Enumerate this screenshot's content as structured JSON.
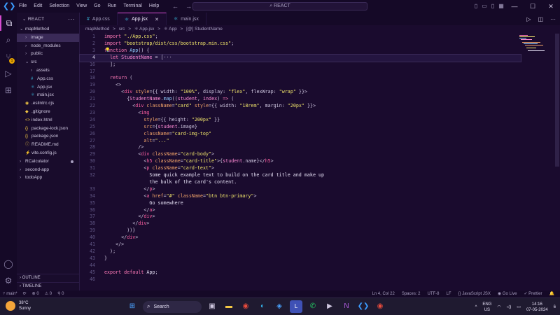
{
  "titlebar": {
    "menu": [
      "File",
      "Edit",
      "Selection",
      "View",
      "Go",
      "Run",
      "Terminal",
      "Help"
    ],
    "search_text": "REACT",
    "back_arrow": "←",
    "forward_arrow": "→"
  },
  "sidebar": {
    "header": "REACT",
    "more": "···",
    "items": [
      {
        "label": "mapMethod",
        "depth": 0,
        "type": "folder-open"
      },
      {
        "label": "image",
        "depth": 1,
        "type": "folder",
        "selected": true
      },
      {
        "label": "node_modules",
        "depth": 1,
        "type": "folder"
      },
      {
        "label": "public",
        "depth": 1,
        "type": "folder"
      },
      {
        "label": "src",
        "depth": 1,
        "type": "folder-open"
      },
      {
        "label": "assets",
        "depth": 2,
        "type": "folder"
      },
      {
        "label": "App.css",
        "depth": 2,
        "type": "css",
        "icon": "#"
      },
      {
        "label": "App.jsx",
        "depth": 2,
        "type": "react",
        "icon": "⚛"
      },
      {
        "label": "main.jsx",
        "depth": 2,
        "type": "react",
        "icon": "⚛"
      },
      {
        "label": ".eslintrc.cjs",
        "depth": 1,
        "type": "file",
        "icon": "◉"
      },
      {
        "label": ".gitignore",
        "depth": 1,
        "type": "file",
        "icon": "◆"
      },
      {
        "label": "index.html",
        "depth": 1,
        "type": "file",
        "icon": "<>"
      },
      {
        "label": "package-lock.json",
        "depth": 1,
        "type": "file",
        "icon": "{}"
      },
      {
        "label": "package.json",
        "depth": 1,
        "type": "file",
        "icon": "{}"
      },
      {
        "label": "README.md",
        "depth": 1,
        "type": "file",
        "icon": "ⓘ"
      },
      {
        "label": "vite.config.js",
        "depth": 1,
        "type": "file",
        "icon": "⚡"
      },
      {
        "label": "RCalculator",
        "depth": 0,
        "type": "folder",
        "modified": true
      },
      {
        "label": "second-app",
        "depth": 0,
        "type": "folder"
      },
      {
        "label": "todoApp",
        "depth": 0,
        "type": "folder"
      }
    ],
    "outline": "OUTLINE",
    "timeline": "TIMELINE"
  },
  "tabs": [
    {
      "label": "App.css",
      "icon": "#",
      "active": false
    },
    {
      "label": "App.jsx",
      "icon": "⚛",
      "active": true,
      "close": "✕"
    },
    {
      "label": "main.jsx",
      "icon": "⚛",
      "active": false
    }
  ],
  "breadcrumb": [
    "mapMethod",
    ">",
    "src",
    ">",
    "⚛ App.jsx",
    ">",
    "⚛ App",
    ">",
    "[@] StudentName"
  ],
  "editor": {
    "current_line": 4,
    "lines": [
      {
        "n": "1",
        "t": [
          [
            "t-kw",
            "import "
          ],
          [
            "t-str",
            "\"./App.css\""
          ],
          [
            "t-pun",
            ";"
          ]
        ]
      },
      {
        "n": "2",
        "t": [
          [
            "t-kw",
            "import "
          ],
          [
            "t-str",
            "\"bootstrap/dist/css/bootstrap.min.css\""
          ],
          [
            "t-pun",
            ";"
          ]
        ]
      },
      {
        "n": "3",
        "t": [
          [
            "t-kw",
            "function "
          ],
          [
            "t-fn",
            "App"
          ],
          [
            "t-pun",
            "() {"
          ]
        ]
      },
      {
        "n": "4",
        "t": [
          [
            "t-pun",
            "  "
          ],
          [
            "t-kw",
            "let "
          ],
          [
            "t-var",
            "StudentName"
          ],
          [
            "t-pun",
            " = "
          ],
          [
            "t-pun",
            "[···"
          ]
        ]
      },
      {
        "n": "16",
        "t": [
          [
            "t-pun",
            "  ];"
          ]
        ]
      },
      {
        "n": "17",
        "t": [
          [
            "t-pun",
            ""
          ]
        ]
      },
      {
        "n": "18",
        "t": [
          [
            "t-pun",
            "  "
          ],
          [
            "t-kw",
            "return"
          ],
          [
            "t-pun",
            " ("
          ]
        ]
      },
      {
        "n": "19",
        "t": [
          [
            "t-pun",
            "    <>"
          ]
        ]
      },
      {
        "n": "20",
        "t": [
          [
            "t-pun",
            "      <"
          ],
          [
            "t-tag",
            "div"
          ],
          [
            "t-attr",
            " style"
          ],
          [
            "t-pun",
            "={{ width: "
          ],
          [
            "t-str",
            "\"100%\""
          ],
          [
            "t-pun",
            ", display: "
          ],
          [
            "t-str",
            "\"flex\""
          ],
          [
            "t-pun",
            ", flexWrap: "
          ],
          [
            "t-str",
            "\"wrap\""
          ],
          [
            "t-pun",
            " }}>"
          ]
        ]
      },
      {
        "n": "21",
        "t": [
          [
            "t-pun",
            "        {"
          ],
          [
            "t-var",
            "StudentName"
          ],
          [
            "t-pun",
            "."
          ],
          [
            "t-fn",
            "map"
          ],
          [
            "t-pun",
            "(("
          ],
          [
            "t-var",
            "student"
          ],
          [
            "t-pun",
            ", "
          ],
          [
            "t-var",
            "index"
          ],
          [
            "t-pun",
            ") "
          ],
          [
            "t-kw",
            "=>"
          ],
          [
            "t-pun",
            " ("
          ]
        ]
      },
      {
        "n": "22",
        "t": [
          [
            "t-pun",
            "          <"
          ],
          [
            "t-tag",
            "div"
          ],
          [
            "t-attr",
            " className"
          ],
          [
            "t-pun",
            "="
          ],
          [
            "t-str",
            "\"card\""
          ],
          [
            "t-attr",
            " style"
          ],
          [
            "t-pun",
            "={{ width: "
          ],
          [
            "t-str",
            "\"18rem\""
          ],
          [
            "t-pun",
            ", margin: "
          ],
          [
            "t-str",
            "\"20px\""
          ],
          [
            "t-pun",
            " }}>"
          ]
        ]
      },
      {
        "n": "23",
        "t": [
          [
            "t-pun",
            "            <"
          ],
          [
            "t-tag",
            "img"
          ]
        ]
      },
      {
        "n": "24",
        "t": [
          [
            "t-attr",
            "              style"
          ],
          [
            "t-pun",
            "={{ height: "
          ],
          [
            "t-str",
            "\"200px\""
          ],
          [
            "t-pun",
            " }}"
          ]
        ]
      },
      {
        "n": "25",
        "t": [
          [
            "t-attr",
            "              src"
          ],
          [
            "t-pun",
            "={"
          ],
          [
            "t-var",
            "student"
          ],
          [
            "t-pun",
            ".image}"
          ]
        ]
      },
      {
        "n": "26",
        "t": [
          [
            "t-attr",
            "              className"
          ],
          [
            "t-pun",
            "="
          ],
          [
            "t-str",
            "\"card-img-top\""
          ]
        ]
      },
      {
        "n": "27",
        "t": [
          [
            "t-attr",
            "              alt"
          ],
          [
            "t-pun",
            "="
          ],
          [
            "t-str",
            "\"...\""
          ]
        ]
      },
      {
        "n": "28",
        "t": [
          [
            "t-pun",
            "            />"
          ]
        ]
      },
      {
        "n": "29",
        "t": [
          [
            "t-pun",
            "            <"
          ],
          [
            "t-tag",
            "div"
          ],
          [
            "t-attr",
            " className"
          ],
          [
            "t-pun",
            "="
          ],
          [
            "t-str",
            "\"card-body\""
          ],
          [
            "t-pun",
            ">"
          ]
        ]
      },
      {
        "n": "30",
        "t": [
          [
            "t-pun",
            "              <"
          ],
          [
            "t-tag",
            "h5"
          ],
          [
            "t-attr",
            " className"
          ],
          [
            "t-pun",
            "="
          ],
          [
            "t-str",
            "\"card-title\""
          ],
          [
            "t-pun",
            ">{"
          ],
          [
            "t-var",
            "student"
          ],
          [
            "t-pun",
            ".name}</"
          ],
          [
            "t-tag",
            "h5"
          ],
          [
            "t-pun",
            ">"
          ]
        ]
      },
      {
        "n": "31",
        "t": [
          [
            "t-pun",
            "              <"
          ],
          [
            "t-tag",
            "p"
          ],
          [
            "t-attr",
            " className"
          ],
          [
            "t-pun",
            "="
          ],
          [
            "t-str",
            "\"card-text\""
          ],
          [
            "t-pun",
            ">"
          ]
        ]
      },
      {
        "n": "32",
        "t": [
          [
            "t-txt",
            "                Some quick example text to build on the card title and make up"
          ]
        ]
      },
      {
        "n": "",
        "t": [
          [
            "t-txt",
            "                the bulk of the card's content."
          ]
        ]
      },
      {
        "n": "33",
        "t": [
          [
            "t-pun",
            "              </"
          ],
          [
            "t-tag",
            "p"
          ],
          [
            "t-pun",
            ">"
          ]
        ]
      },
      {
        "n": "34",
        "t": [
          [
            "t-pun",
            "              <"
          ],
          [
            "t-tag",
            "a"
          ],
          [
            "t-attr",
            " href"
          ],
          [
            "t-pun",
            "="
          ],
          [
            "t-str",
            "\"#\""
          ],
          [
            "t-attr",
            " className"
          ],
          [
            "t-pun",
            "="
          ],
          [
            "t-str",
            "\"btn btn-primary\""
          ],
          [
            "t-pun",
            ">"
          ]
        ]
      },
      {
        "n": "35",
        "t": [
          [
            "t-txt",
            "                Go somewhere"
          ]
        ]
      },
      {
        "n": "36",
        "t": [
          [
            "t-pun",
            "              </"
          ],
          [
            "t-tag",
            "a"
          ],
          [
            "t-pun",
            ">"
          ]
        ]
      },
      {
        "n": "37",
        "t": [
          [
            "t-pun",
            "            </"
          ],
          [
            "t-tag",
            "div"
          ],
          [
            "t-pun",
            ">"
          ]
        ]
      },
      {
        "n": "38",
        "t": [
          [
            "t-pun",
            "          </"
          ],
          [
            "t-tag",
            "div"
          ],
          [
            "t-pun",
            ">"
          ]
        ]
      },
      {
        "n": "39",
        "t": [
          [
            "t-pun",
            "        ))}"
          ]
        ]
      },
      {
        "n": "40",
        "t": [
          [
            "t-pun",
            "      </"
          ],
          [
            "t-tag",
            "div"
          ],
          [
            "t-pun",
            ">"
          ]
        ]
      },
      {
        "n": "41",
        "t": [
          [
            "t-pun",
            "    </>"
          ]
        ]
      },
      {
        "n": "42",
        "t": [
          [
            "t-pun",
            "  );"
          ]
        ]
      },
      {
        "n": "43",
        "t": [
          [
            "t-pun",
            "}"
          ]
        ]
      },
      {
        "n": "44",
        "t": [
          [
            "t-pun",
            ""
          ]
        ]
      },
      {
        "n": "45",
        "t": [
          [
            "t-kw",
            "export default "
          ],
          [
            "t-txt",
            "App"
          ],
          [
            "t-pun",
            ";"
          ]
        ]
      },
      {
        "n": "46",
        "t": [
          [
            "t-pun",
            ""
          ]
        ]
      }
    ]
  },
  "statusbar": {
    "branch": "main*",
    "sync": "⟳",
    "errors": "⊗ 0",
    "warnings": "⚠ 0",
    "ports": "⚲ 0",
    "position": "Ln 4, Col 22",
    "spaces": "Spaces: 2",
    "encoding": "UTF-8",
    "eol": "LF",
    "language": "{} JavaScript JSX",
    "golive": "Go Live",
    "prettier": "✓ Prettier",
    "bell": "🔔"
  },
  "taskbar": {
    "temperature": "38°C",
    "condition": "Sunny",
    "search_label": "Search",
    "lang_top": "ENG",
    "lang_bottom": "US",
    "time": "14:16",
    "date": "07-05-2024",
    "notification_count": "6"
  },
  "colors": {
    "accent": "#d44bd0",
    "background": "#1a0b2e",
    "keyword": "#ff7ab8",
    "string": "#f1e56b"
  }
}
